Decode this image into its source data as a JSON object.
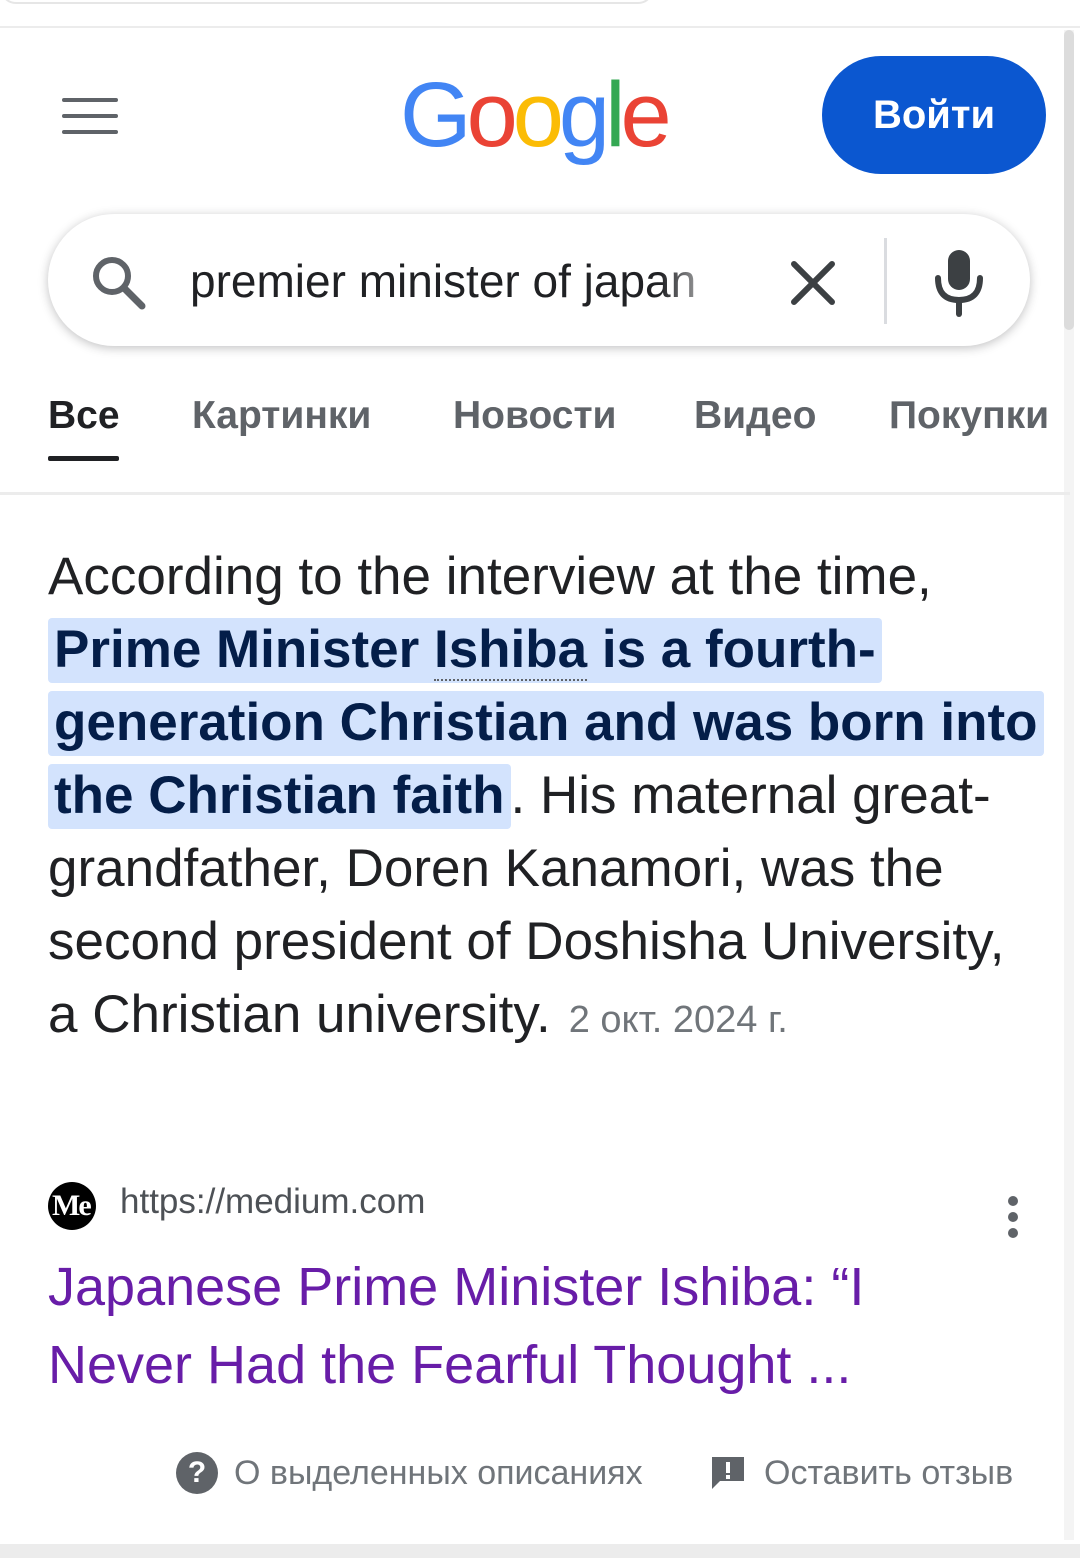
{
  "header": {
    "logo_text": "Google",
    "signin_label": "Войти"
  },
  "search": {
    "query": "premier minister of japan"
  },
  "tabs": [
    {
      "label": "Все",
      "active": true
    },
    {
      "label": "Картинки",
      "active": false
    },
    {
      "label": "Новости",
      "active": false
    },
    {
      "label": "Видео",
      "active": false
    },
    {
      "label": "Покупки",
      "active": false
    }
  ],
  "snippet": {
    "text_before": "According to the interview at the time, ",
    "highlight_1": "Prime Minister ",
    "highlight_ishiba": "Ishiba",
    "highlight_2": " is a fourth-generation Christian and was born into the Christian faith",
    "text_after": ". His maternal great-grandfather, Doren Kanamori, was the second president of Doshisha University, a Christian university.",
    "date": "2 окт. 2024 г."
  },
  "source": {
    "favicon_text": "Me",
    "url": "https://medium.com",
    "title": "Japanese Prime Minister Ishiba: “I Never Had the Fearful Thought ..."
  },
  "footer": {
    "about_label": "О выделенных описаниях",
    "feedback_label": "Оставить отзыв"
  },
  "colors": {
    "signin_bg": "#0b57d0",
    "highlight_bg": "#d3e3fd",
    "visited_link": "#681da8"
  }
}
